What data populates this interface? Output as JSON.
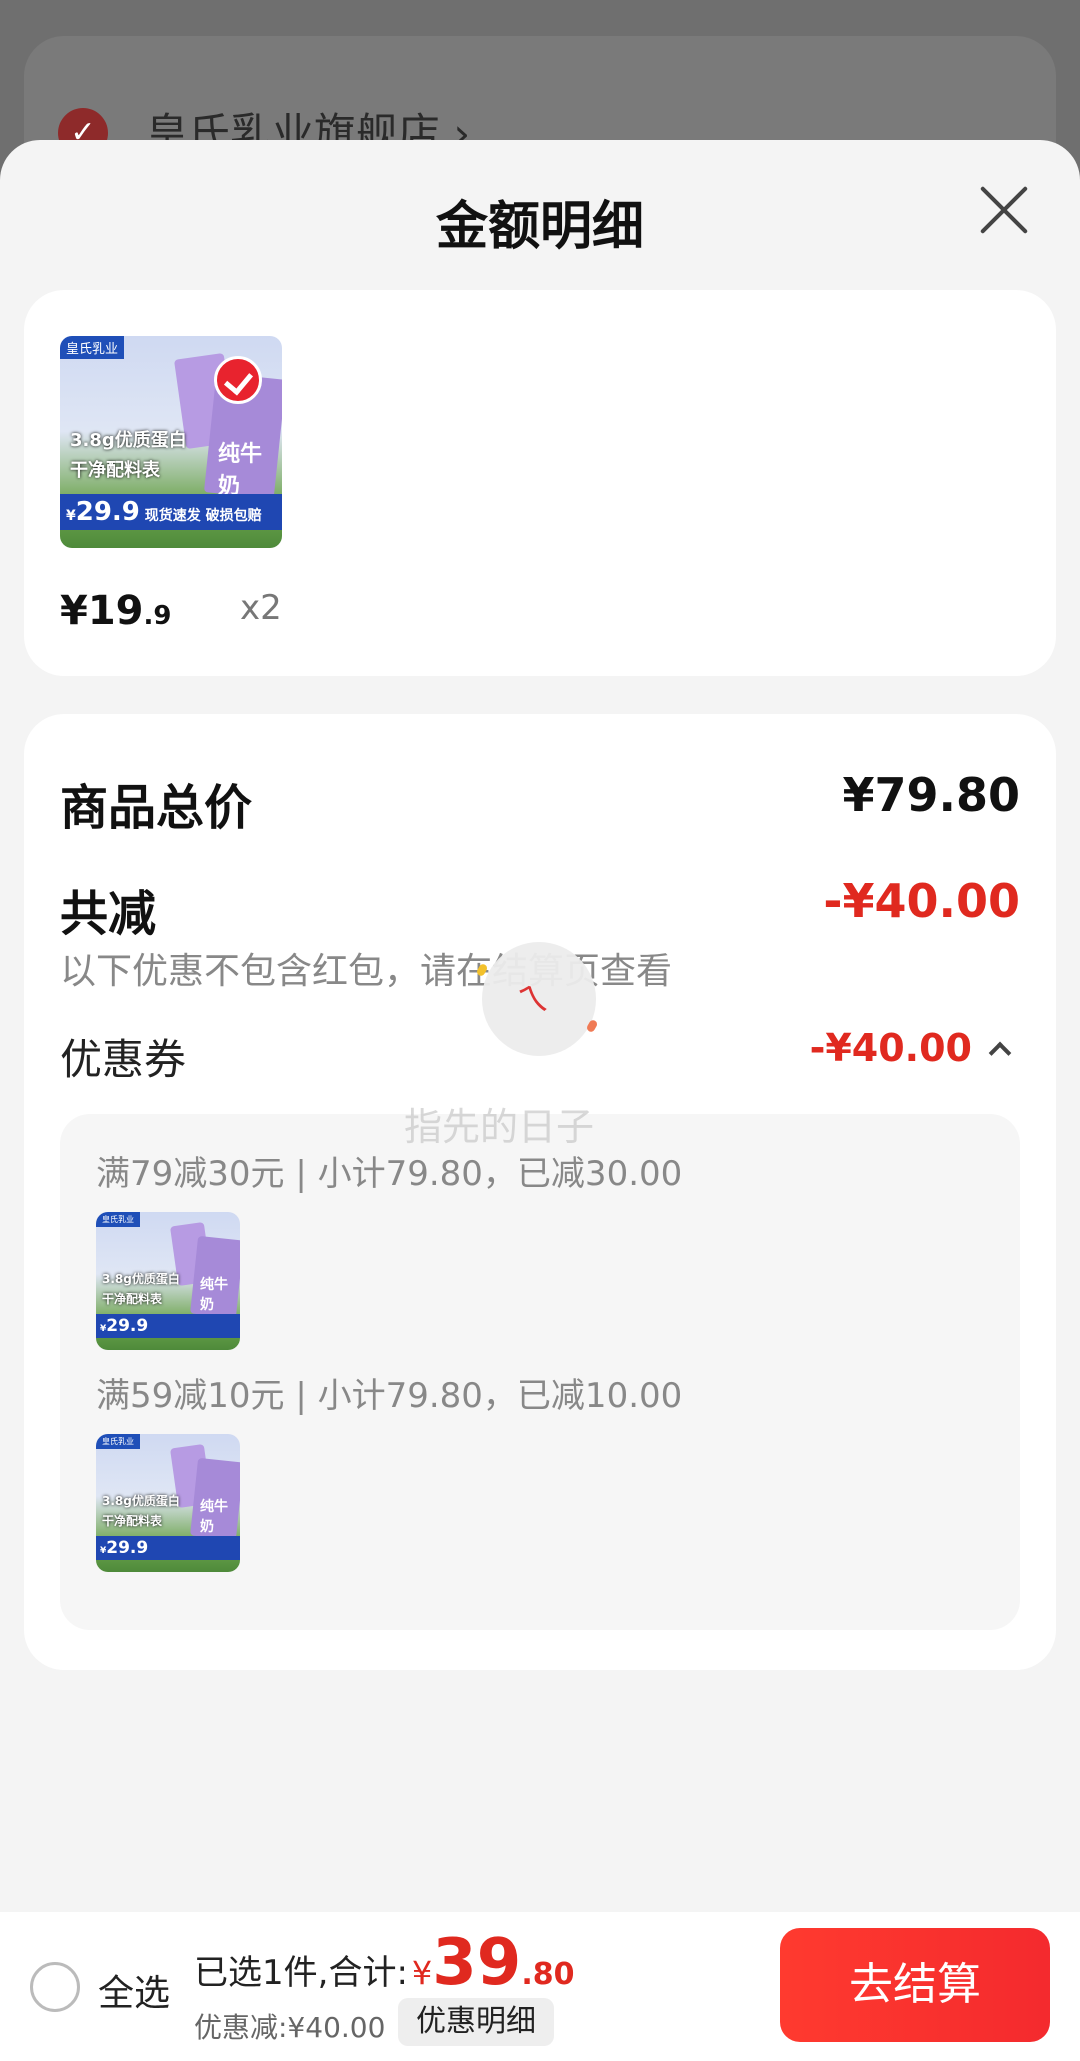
{
  "background": {
    "store_name": "皇氏乳业旗舰店 ›"
  },
  "sheet": {
    "title": "金额明细"
  },
  "product": {
    "thumb": {
      "tag": "皇氏乳业",
      "line1": "3.8g优质蛋白",
      "line2": "干净配料表",
      "box_text": "纯牛奶",
      "price_prefix": "¥",
      "price": "29.9",
      "price_note": "现货速发 破损包赔"
    },
    "price_int": "¥19",
    "price_dec": ".9",
    "qty": "x2"
  },
  "summary": {
    "total_label": "商品总价",
    "total_value": "¥79.80",
    "minus_label": "共减",
    "minus_value": "-¥40.00",
    "note": "以下优惠不包含红包，请在结算页查看",
    "coupon_label": "优惠券",
    "coupon_value": "-¥40.00",
    "coupons": [
      {
        "text": "满79减30元 | 小计79.80，已减30.00"
      },
      {
        "text": "满59减10元 | 小计79.80，已减10.00"
      }
    ]
  },
  "loading": {
    "caption": "指先的日子"
  },
  "bottom": {
    "select_all": "全选",
    "selected_text": "已选1件,合计:",
    "total_currency": "¥",
    "total_int": "39",
    "total_dec": ".80",
    "discount_text": "优惠减:¥40.00",
    "detail_label": "优惠明细",
    "checkout_label": "去结算"
  },
  "colors": {
    "accent_red": "#e0291f",
    "checkout_red": "#ff3a2f"
  }
}
